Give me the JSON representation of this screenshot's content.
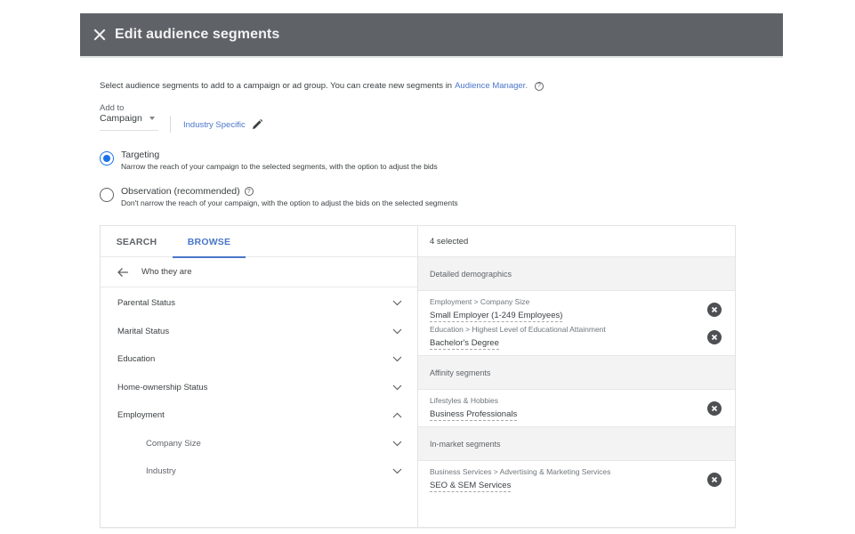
{
  "header": {
    "title": "Edit audience segments",
    "close_icon": "close-icon"
  },
  "intro": {
    "text": "Select audience segments to add to a campaign or ad group. You can create new segments in",
    "link": "Audience Manager.",
    "help_icon": "help-circle-icon"
  },
  "add_to": {
    "label": "Add to",
    "selected": "Campaign",
    "segment_name": "Industry Specific",
    "edit_icon": "pencil-icon"
  },
  "options": [
    {
      "title": "Targeting",
      "description": "Narrow the reach of your campaign to the selected segments, with the option to adjust the bids",
      "selected": true
    },
    {
      "title": "Observation (recommended)",
      "description": "Don't narrow the reach of your campaign, with the option to adjust the bids on the selected segments",
      "selected": false,
      "has_help": true
    }
  ],
  "browser": {
    "tabs": [
      {
        "label": "SEARCH",
        "active": false
      },
      {
        "label": "BROWSE",
        "active": true
      }
    ],
    "breadcrumb": "Who they are",
    "categories": [
      {
        "label": "Parental Status",
        "expanded": false,
        "level": 0
      },
      {
        "label": "Marital Status",
        "expanded": false,
        "level": 0
      },
      {
        "label": "Education",
        "expanded": false,
        "level": 0
      },
      {
        "label": "Home-ownership Status",
        "expanded": false,
        "level": 0
      },
      {
        "label": "Employment",
        "expanded": true,
        "level": 0
      },
      {
        "label": "Company Size",
        "expanded": false,
        "level": 1
      },
      {
        "label": "Industry",
        "expanded": false,
        "level": 1
      }
    ]
  },
  "selected": {
    "count_label": "4 selected",
    "groups": [
      {
        "heading": "Detailed demographics",
        "items": [
          {
            "path": "Employment > Company Size",
            "name": "Small Employer (1-249 Employees)"
          },
          {
            "path": "Education > Highest Level of Educational Attainment",
            "name": "Bachelor's Degree"
          }
        ]
      },
      {
        "heading": "Affinity segments",
        "items": [
          {
            "path": "Lifestyles & Hobbies",
            "name": "Business Professionals"
          }
        ]
      },
      {
        "heading": "In-market segments",
        "items": [
          {
            "path": "Business Services > Advertising & Marketing Services",
            "name": "SEO & SEM Services"
          }
        ]
      }
    ]
  },
  "colors": {
    "header_bg": "#5f6368",
    "accent": "#4a76c9",
    "radio_selected": "#1a73e8",
    "group_bg": "#f3f3f3",
    "remove_icon": "#4d4f52"
  }
}
